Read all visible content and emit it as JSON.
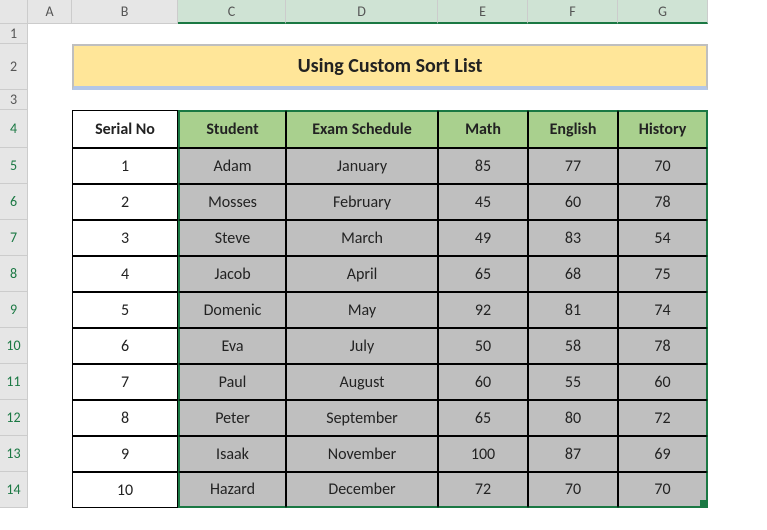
{
  "columns": [
    "A",
    "B",
    "C",
    "D",
    "E",
    "F",
    "G"
  ],
  "rows": [
    "1",
    "2",
    "3",
    "4",
    "5",
    "6",
    "7",
    "8",
    "9",
    "10",
    "11",
    "12",
    "13",
    "14"
  ],
  "title": "Using Custom Sort List",
  "headers": {
    "serial": "Serial No",
    "student": "Student",
    "schedule": "Exam Schedule",
    "math": "Math",
    "english": "English",
    "history": "History"
  },
  "data": [
    {
      "serial": "1",
      "student": "Adam",
      "schedule": "January",
      "math": "85",
      "english": "77",
      "history": "70"
    },
    {
      "serial": "2",
      "student": "Mosses",
      "schedule": "February",
      "math": "45",
      "english": "60",
      "history": "78"
    },
    {
      "serial": "3",
      "student": "Steve",
      "schedule": "March",
      "math": "49",
      "english": "83",
      "history": "54"
    },
    {
      "serial": "4",
      "student": "Jacob",
      "schedule": "April",
      "math": "65",
      "english": "68",
      "history": "75"
    },
    {
      "serial": "5",
      "student": "Domenic",
      "schedule": "May",
      "math": "92",
      "english": "81",
      "history": "74"
    },
    {
      "serial": "6",
      "student": "Eva",
      "schedule": "July",
      "math": "50",
      "english": "58",
      "history": "78"
    },
    {
      "serial": "7",
      "student": "Paul",
      "schedule": "August",
      "math": "60",
      "english": "55",
      "history": "60"
    },
    {
      "serial": "8",
      "student": "Peter",
      "schedule": "September",
      "math": "65",
      "english": "80",
      "history": "72"
    },
    {
      "serial": "9",
      "student": "Isaak",
      "schedule": "November",
      "math": "100",
      "english": "87",
      "history": "69"
    },
    {
      "serial": "10",
      "student": "Hazard",
      "schedule": "December",
      "math": "72",
      "english": "70",
      "history": "70"
    }
  ],
  "chart_data": {
    "type": "table",
    "title": "Using Custom Sort List",
    "columns": [
      "Serial No",
      "Student",
      "Exam Schedule",
      "Math",
      "English",
      "History"
    ],
    "rows": [
      [
        1,
        "Adam",
        "January",
        85,
        77,
        70
      ],
      [
        2,
        "Mosses",
        "February",
        45,
        60,
        78
      ],
      [
        3,
        "Steve",
        "March",
        49,
        83,
        54
      ],
      [
        4,
        "Jacob",
        "April",
        65,
        68,
        75
      ],
      [
        5,
        "Domenic",
        "May",
        92,
        81,
        74
      ],
      [
        6,
        "Eva",
        "July",
        50,
        58,
        78
      ],
      [
        7,
        "Paul",
        "August",
        60,
        55,
        60
      ],
      [
        8,
        "Peter",
        "September",
        65,
        80,
        72
      ],
      [
        9,
        "Isaak",
        "November",
        100,
        87,
        69
      ],
      [
        10,
        "Hazard",
        "December",
        72,
        70,
        70
      ]
    ]
  }
}
